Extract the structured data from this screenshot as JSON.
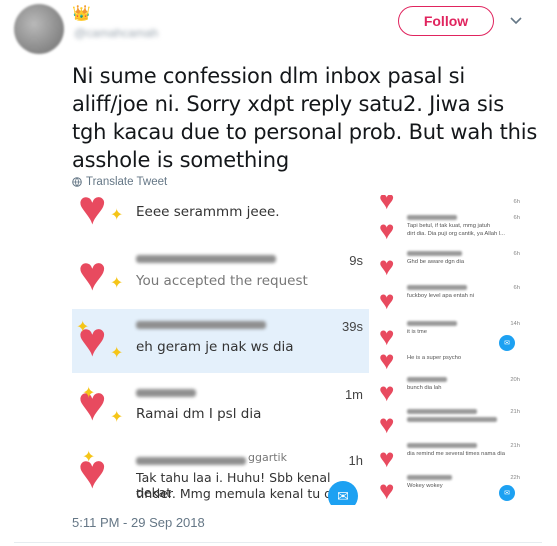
{
  "header": {
    "crown_emoji": "👑",
    "handle": "@camahcamah",
    "follow_label": "Follow",
    "chevron_icon": "chevron-down-icon"
  },
  "tweet": {
    "text": "Ni sume confession dlm inbox pasal si aliff/joe ni. Sorry xdpt reply satu2. Jiwa sis tgh kacau due to personal prob. But wah this asshole is something",
    "translate_label": "Translate Tweet",
    "timestamp": "5:11 PM - 29 Sep 2018"
  },
  "left_screenshot": {
    "rows": [
      {
        "message": "Eeee serammm jeee.",
        "time": ""
      },
      {
        "message": "You accepted the request",
        "time": "9s"
      },
      {
        "message": "eh geram je nak ws dia",
        "time": "39s"
      },
      {
        "message": "Ramai dm I psl dia",
        "time": "1m"
      },
      {
        "name_suffix": "ggartik",
        "message_line1": "Tak tahu laa i. Huhu! Sbb kenal dekat",
        "message_line2": "tinder. Mmg memula kenal tu dia",
        "time": "1h"
      }
    ]
  },
  "right_screenshot": {
    "rows": [
      {
        "message": "",
        "time": "6h"
      },
      {
        "message": "Tapi betul, if tak kuat, mmg jatuh",
        "message2": "dirt dia. Dia puji org cantik, ya Allah l...",
        "time": "6h"
      },
      {
        "message": "Ghd be aware dgn dia",
        "time": "6h"
      },
      {
        "message": "fuckboy level apa entah ni",
        "time": "6h"
      },
      {
        "message": "it is tme",
        "time": "14h"
      },
      {
        "message": "He is a super psycho",
        "time": ""
      },
      {
        "message": "bunch dia lah",
        "time": "20h"
      },
      {
        "message": "",
        "time": "21h"
      },
      {
        "message": "dia remind me several times nama dia",
        "time": "21h"
      },
      {
        "message": "Wokey wokey",
        "time": "22h"
      }
    ]
  }
}
